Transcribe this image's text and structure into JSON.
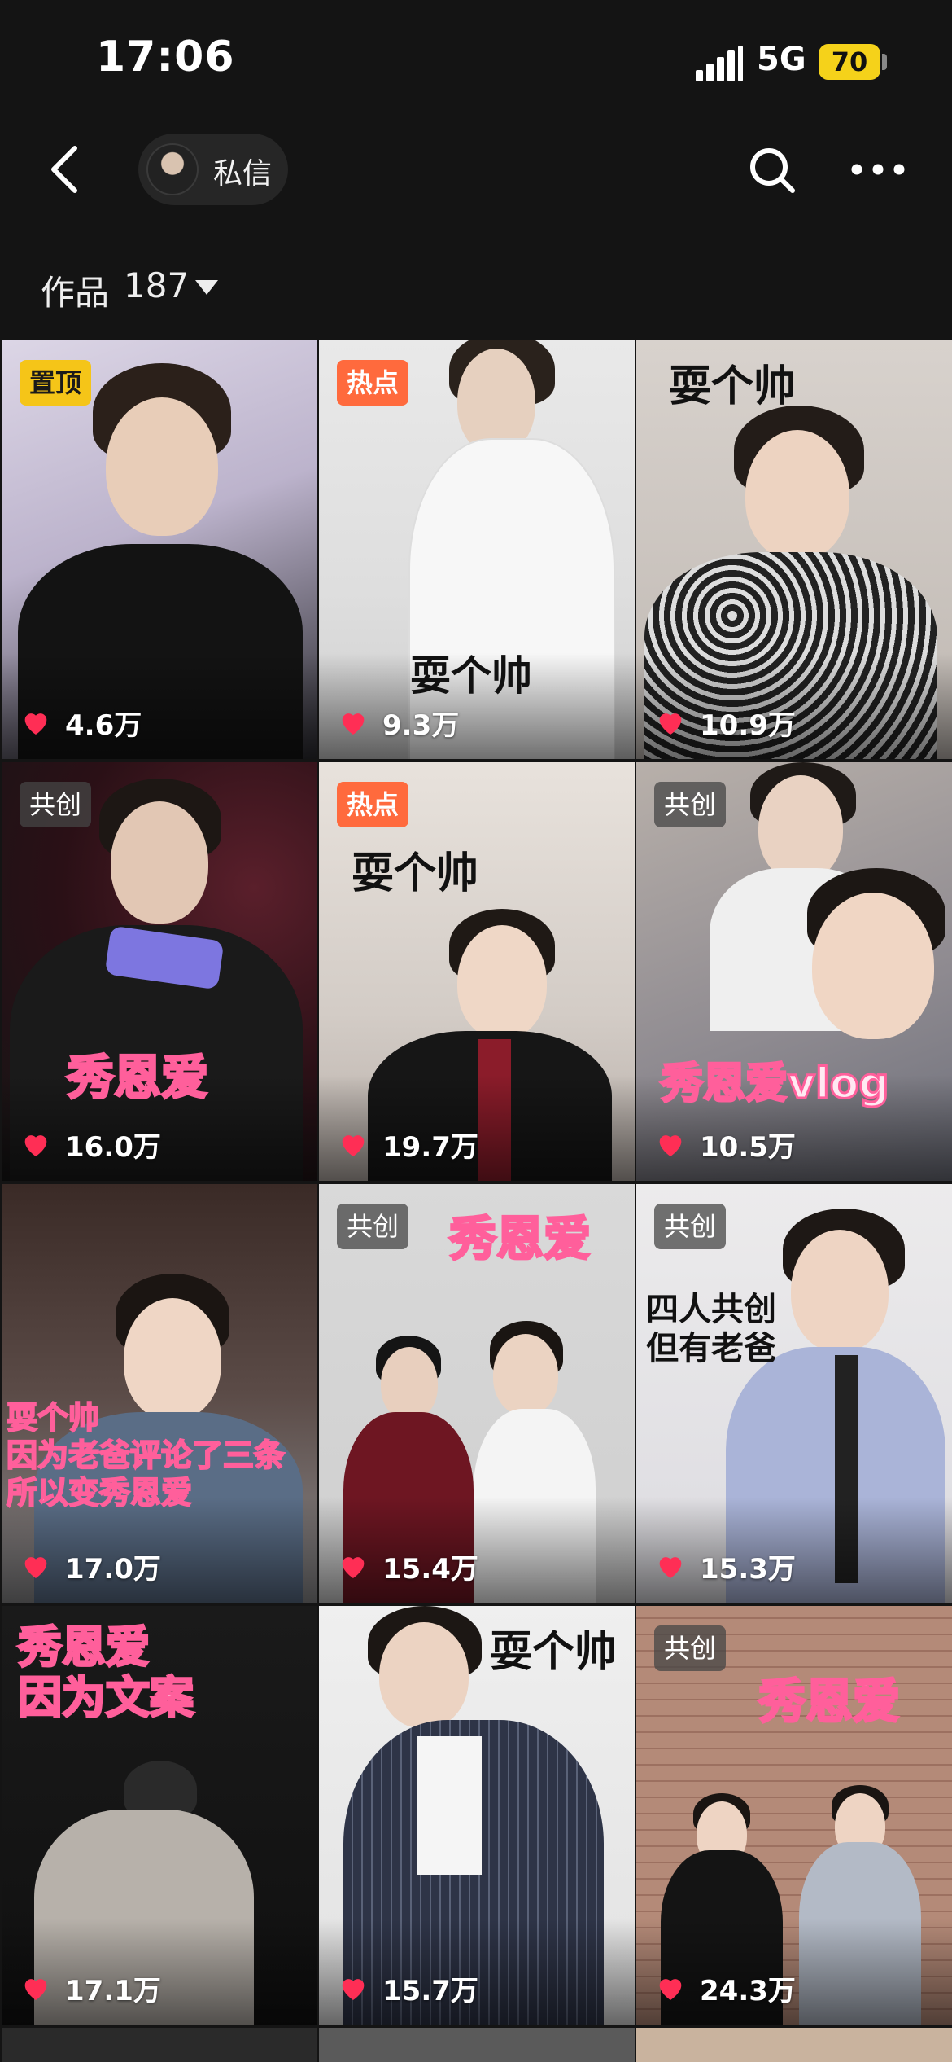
{
  "status_bar": {
    "time": "17:06",
    "network": "5G",
    "battery": "70"
  },
  "nav": {
    "chat_label": "私信"
  },
  "works": {
    "label": "作品",
    "count": "187"
  },
  "icons": {
    "back": "chevron-left-icon",
    "search": "search-icon",
    "more": "more-horizontal-icon",
    "like": "heart-icon"
  },
  "colors": {
    "background": "#141414",
    "like": "#ff2e55",
    "badge_pinned": "#f5c518",
    "badge_hot": "#ff6a3d",
    "caption_pink": "#ff5f9b"
  },
  "videos": [
    {
      "badge": "置顶",
      "caption": "",
      "likes": "4.6万"
    },
    {
      "badge": "热点",
      "caption": "耍个帅",
      "likes": "9.3万"
    },
    {
      "badge": "",
      "caption": "耍个帅",
      "likes": "10.9万"
    },
    {
      "badge": "共创",
      "caption": "秀恩爱",
      "likes": "16.0万"
    },
    {
      "badge": "热点",
      "caption": "耍个帅",
      "likes": "19.7万"
    },
    {
      "badge": "共创",
      "caption": "秀恩爱vlog",
      "likes": "10.5万"
    },
    {
      "badge": "",
      "caption": "耍个帅\n因为老爸评论了三条\n所以变秀恩爱",
      "likes": "17.0万"
    },
    {
      "badge": "共创",
      "caption": "秀恩爱",
      "likes": "15.4万"
    },
    {
      "badge": "共创",
      "caption": "四人共创\n但有老爸",
      "likes": "15.3万"
    },
    {
      "badge": "",
      "caption": "秀恩爱\n因为文案",
      "likes": "17.1万"
    },
    {
      "badge": "",
      "caption": "耍个帅",
      "likes": "15.7万"
    },
    {
      "badge": "共创",
      "caption": "秀恩爱",
      "likes": "24.3万"
    }
  ]
}
